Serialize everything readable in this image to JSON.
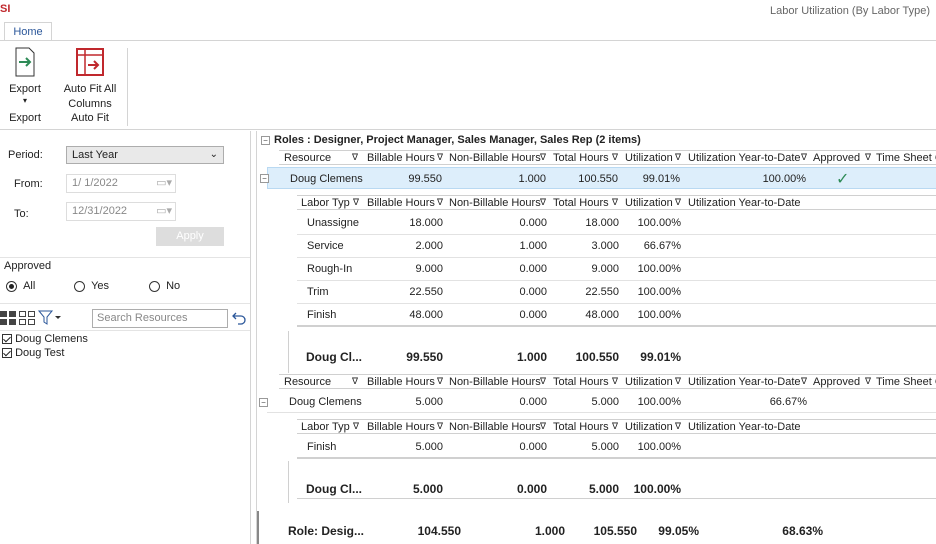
{
  "app": {
    "logo": "SI",
    "window_title": "Labor Utilization (By Labor Type)"
  },
  "ribbon": {
    "tab_home": "Home",
    "export": {
      "label": "Export",
      "arrow": "▾",
      "group": "Export"
    },
    "autofit": {
      "label1": "Auto Fit All",
      "label2": "Columns",
      "group": "Auto Fit"
    }
  },
  "filters": {
    "period_label": "Period:",
    "period_value": "Last Year",
    "from_label": "From:",
    "from_value": "1/ 1/2022",
    "to_label": "To:",
    "to_value": "12/31/2022",
    "apply": "Apply",
    "approved_label": "Approved",
    "approved_options": [
      "All",
      "Yes",
      "No"
    ],
    "search_placeholder": "Search Resources",
    "resources": [
      "Doug Clemens",
      "Doug Test"
    ]
  },
  "grid": {
    "group_title": "Roles : Designer, Project Manager, Sales Manager, Sales Rep (2 items)",
    "resource_headers": [
      "Resource",
      "Billable Hours",
      "Non-Billable Hours",
      "Total Hours",
      "Utilization",
      "Utilization Year-to-Date",
      "Approved",
      "Time Sheet C"
    ],
    "labor_headers": [
      "Labor Typ",
      "Billable Hours",
      "Non-Billable Hours",
      "Total Hours",
      "Utilization",
      "Utilization Year-to-Date"
    ],
    "res1": {
      "name": "Doug Clemens",
      "billable": "99.550",
      "nonbillable": "1.000",
      "total": "100.550",
      "util": "99.01%",
      "ytd": "100.00%",
      "approved": "✓"
    },
    "res1_labor": [
      {
        "type": "Unassigne",
        "billable": "18.000",
        "nonbillable": "0.000",
        "total": "18.000",
        "util": "100.00%"
      },
      {
        "type": "Service",
        "billable": "2.000",
        "nonbillable": "1.000",
        "total": "3.000",
        "util": "66.67%"
      },
      {
        "type": "Rough-In",
        "billable": "9.000",
        "nonbillable": "0.000",
        "total": "9.000",
        "util": "100.00%"
      },
      {
        "type": "Trim",
        "billable": "22.550",
        "nonbillable": "0.000",
        "total": "22.550",
        "util": "100.00%"
      },
      {
        "type": "Finish",
        "billable": "48.000",
        "nonbillable": "0.000",
        "total": "48.000",
        "util": "100.00%"
      }
    ],
    "res1_total": {
      "name": "Doug Cl...",
      "billable": "99.550",
      "nonbillable": "1.000",
      "total": "100.550",
      "util": "99.01%"
    },
    "res2": {
      "name": "Doug Clemens",
      "billable": "5.000",
      "nonbillable": "0.000",
      "total": "5.000",
      "util": "100.00%",
      "ytd": "66.67%"
    },
    "res2_labor": [
      {
        "type": "Finish",
        "billable": "5.000",
        "nonbillable": "0.000",
        "total": "5.000",
        "util": "100.00%"
      }
    ],
    "res2_total": {
      "name": "Doug Cl...",
      "billable": "5.000",
      "nonbillable": "0.000",
      "total": "5.000",
      "util": "100.00%"
    },
    "role_total": {
      "name": "Role: Desig...",
      "billable": "104.550",
      "nonbillable": "1.000",
      "total": "105.550",
      "util": "99.05%",
      "ytd": "68.63%"
    }
  },
  "colors": {
    "accent": "#2b579a",
    "selected_row": "#ddeefb",
    "export_arrow": "#2e8b57",
    "autofit_icon": "#c0282d"
  }
}
